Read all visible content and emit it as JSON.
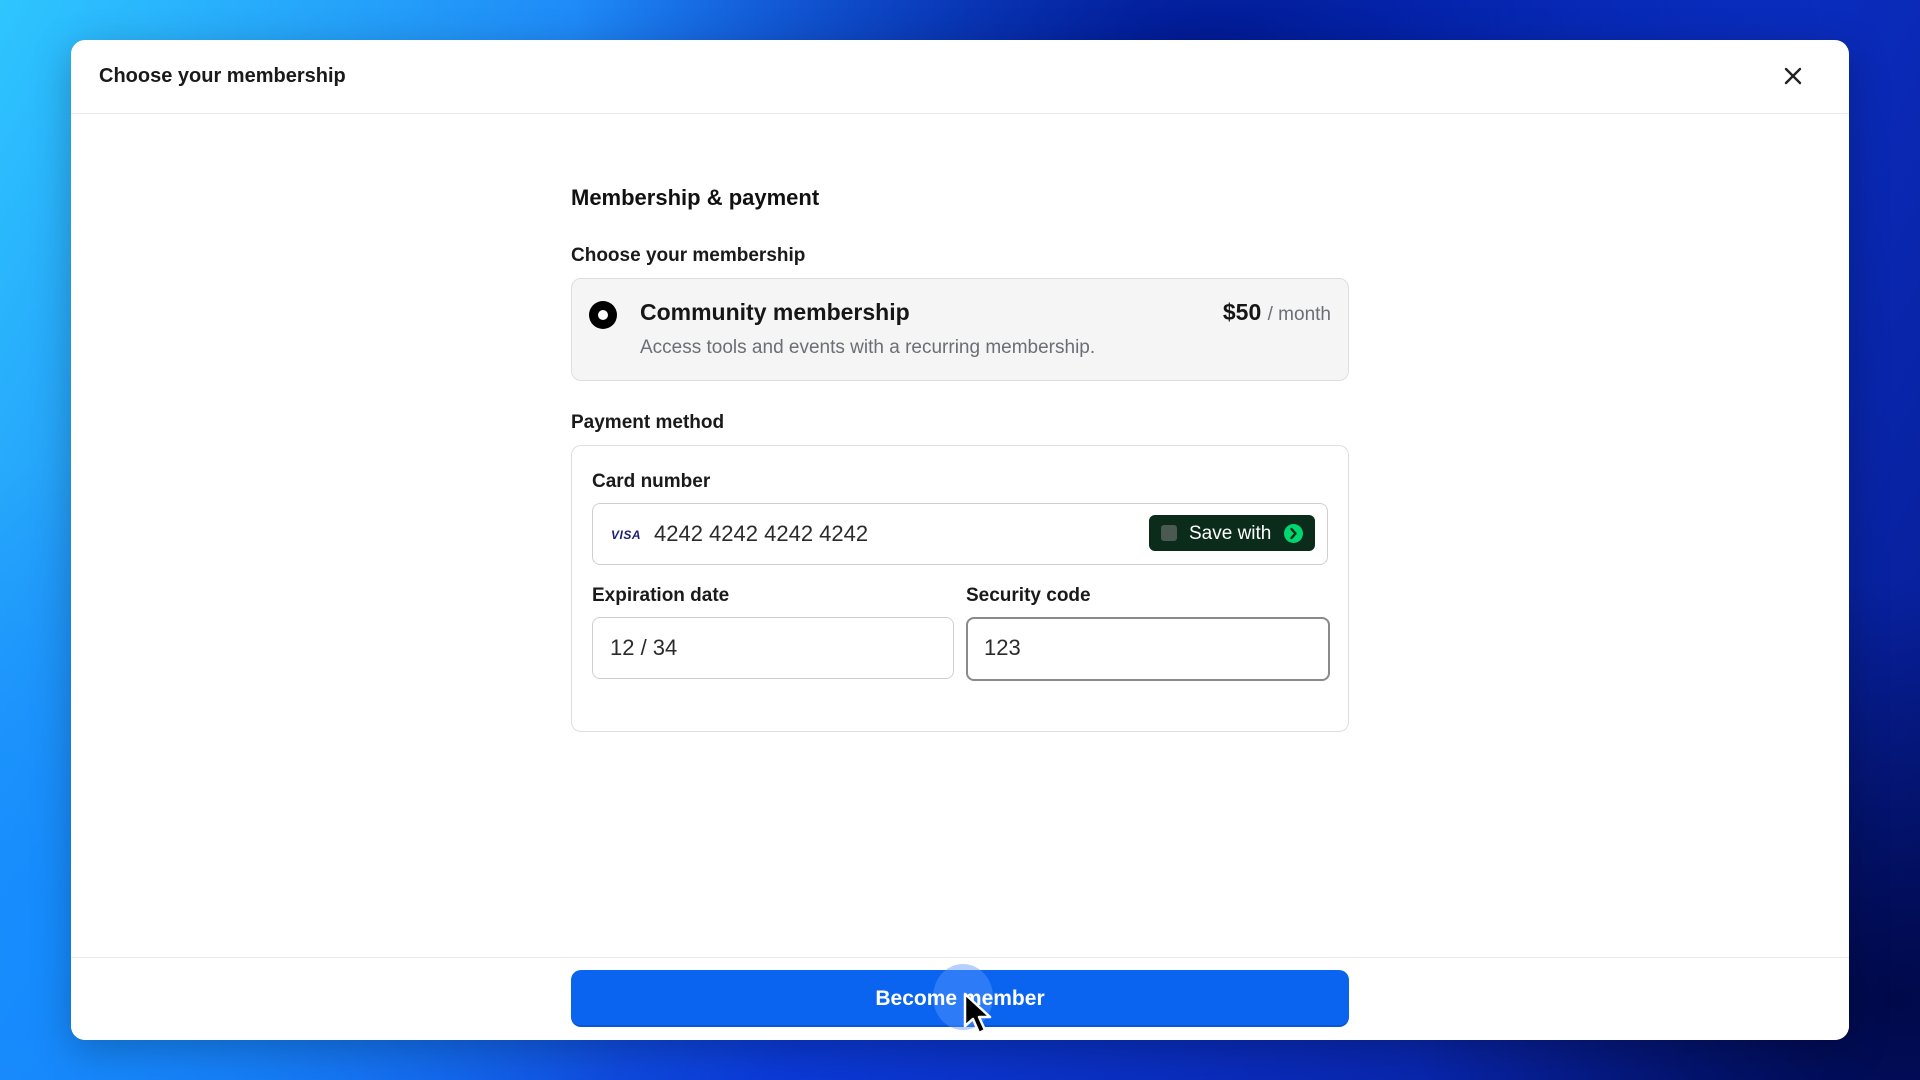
{
  "modal": {
    "title": "Choose your membership"
  },
  "content": {
    "section_title": "Membership & payment",
    "membership_label": "Choose your membership",
    "plan": {
      "name": "Community membership",
      "description": "Access tools and events with a recurring membership.",
      "price": "$50",
      "period": "/ month",
      "selected": true
    },
    "payment_label": "Payment method",
    "card_number_label": "Card number",
    "card_brand": "VISA",
    "card_number_value": "4242 4242 4242 4242",
    "save_with_label": "Save with",
    "expiration_label": "Expiration date",
    "expiration_value": "12 / 34",
    "security_label": "Security code",
    "security_value": "123"
  },
  "footer": {
    "submit_label": "Become member"
  },
  "colors": {
    "primary": "#0a64f0",
    "link_green": "#00d66f",
    "link_dark": "#0b2b1b"
  },
  "icons": {
    "close": "close-icon",
    "radio": "radio-selected-icon",
    "card_brand": "visa-icon",
    "link": "link-arrow-icon",
    "cursor": "mouse-pointer-icon"
  }
}
